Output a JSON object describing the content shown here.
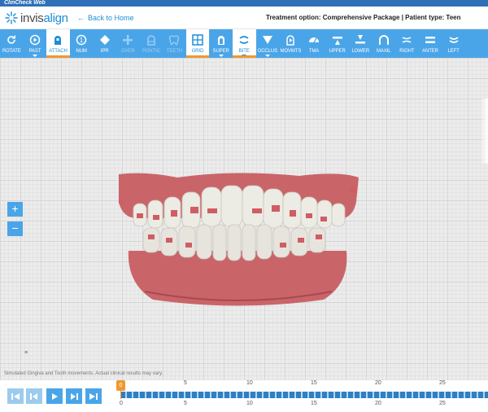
{
  "window": {
    "title": "ClinCheck Web"
  },
  "header": {
    "logo_text_plain": "invis",
    "logo_text_accent": "align",
    "back_label": "Back to Home",
    "treatment_info": "Treatment option: Comprehensive Package | Patient type: Teen"
  },
  "toolbar": {
    "items": [
      {
        "label": "ROTATE",
        "icon": "rotate-icon"
      },
      {
        "label": "PAST",
        "icon": "past-icon"
      },
      {
        "label": "ATTACH",
        "icon": "attach-icon"
      },
      {
        "label": "NUM",
        "icon": "num-icon"
      },
      {
        "label": "IPR",
        "icon": "ipr-icon"
      },
      {
        "label": "OVER",
        "icon": "overlay-icon"
      },
      {
        "label": "PONTIC",
        "icon": "pontic-icon"
      },
      {
        "label": "TEETH",
        "icon": "teeth-icon"
      },
      {
        "label": "GRID",
        "icon": "grid-icon"
      },
      {
        "label": "SUPER",
        "icon": "super-icon"
      },
      {
        "label": "BITE",
        "icon": "bite-icon"
      },
      {
        "label": "OCCLUS",
        "icon": "occlus-icon"
      },
      {
        "label": "MOVMTS",
        "icon": "movements-icon"
      },
      {
        "label": "TMA",
        "icon": "tma-icon"
      },
      {
        "label": "UPPER",
        "icon": "upper-icon"
      },
      {
        "label": "LOWER",
        "icon": "lower-icon"
      },
      {
        "label": "MAXIL",
        "icon": "maxil-icon"
      },
      {
        "label": "RIGHT",
        "icon": "right-icon"
      },
      {
        "label": "ANTER",
        "icon": "anterior-icon"
      },
      {
        "label": "LEFT",
        "icon": "left-icon"
      }
    ]
  },
  "workspace": {
    "zoom_in": "+",
    "zoom_out": "−",
    "small_icon_text": "≡",
    "disclaimer": "Simulated Gingiva and Tooth movements. Actual clinical results may vary."
  },
  "timeline": {
    "current_stage": "0",
    "ticks_top": [
      "5",
      "10",
      "15",
      "20",
      "25"
    ],
    "ticks_bottom": [
      "0",
      "5",
      "10",
      "15",
      "20",
      "25"
    ]
  },
  "colors": {
    "accent": "#4aa5e8",
    "brand_blue": "#1c8ed6",
    "marker_orange": "#f0982d"
  }
}
